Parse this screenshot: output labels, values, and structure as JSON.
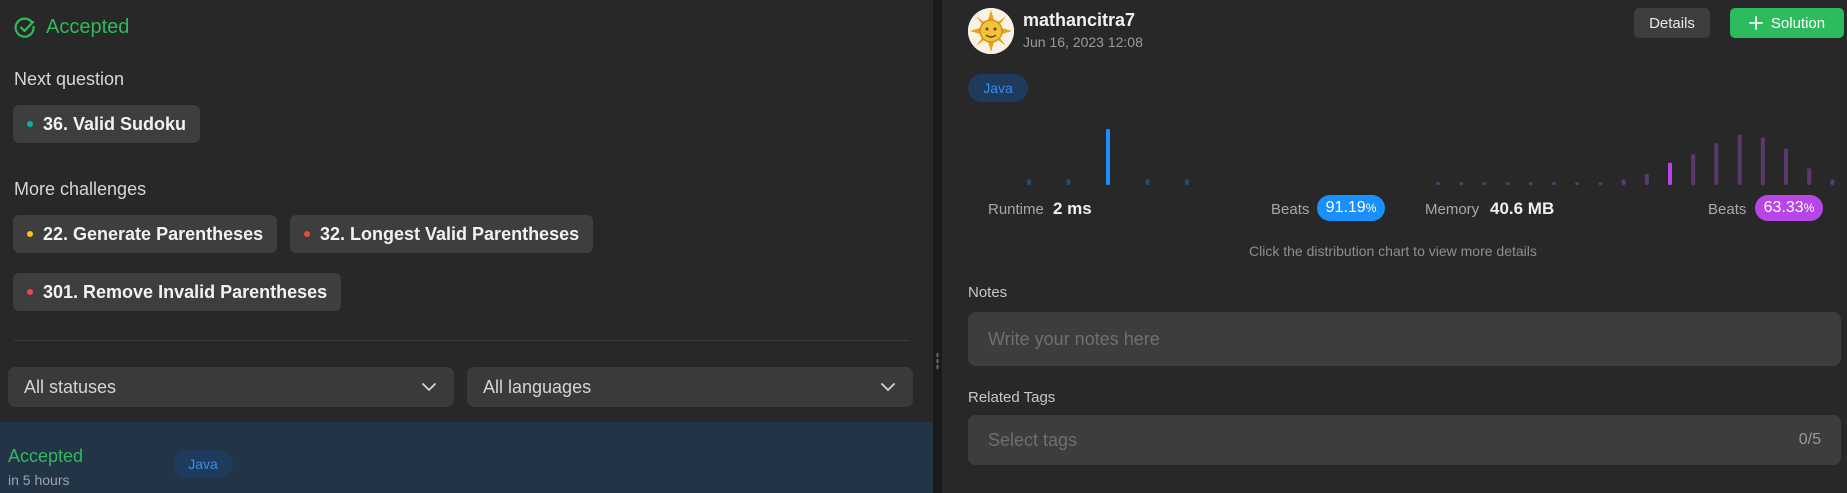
{
  "left": {
    "status_title": "Accepted",
    "next_label": "Next question",
    "next_question": {
      "text": "36. Valid Sudoku",
      "dot": "#00b8a3"
    },
    "more_label": "More challenges",
    "challenges": [
      {
        "text": "22. Generate Parentheses",
        "dot": "#ffc01e"
      },
      {
        "text": "32. Longest Valid Parentheses",
        "dot": "#ef4743"
      },
      {
        "text": "301. Remove Invalid Parentheses",
        "dot": "#ef4743"
      }
    ],
    "filters": {
      "status": "All statuses",
      "language": "All languages"
    },
    "submission": {
      "status": "Accepted",
      "time": "in 5 hours",
      "language": "Java"
    }
  },
  "right": {
    "user": {
      "name": "mathancitra7",
      "date": "Jun 16, 2023 12:08"
    },
    "details_label": "Details",
    "solution_label": "Solution",
    "language": "Java",
    "runtime": {
      "label": "Runtime",
      "value": "2 ms",
      "beats_label": "Beats",
      "beats_main": "91.19",
      "beats_unit": "%"
    },
    "memory": {
      "label": "Memory",
      "value": "40.6 MB",
      "beats_label": "Beats",
      "beats_main": "63.33",
      "beats_unit": "%"
    },
    "hint": "Click the distribution chart to view more details",
    "notes_label": "Notes",
    "notes_placeholder": "Write your notes here",
    "tags_label": "Related Tags",
    "tags_placeholder": "Select tags",
    "tags_count": "0/5"
  },
  "colors": {
    "accent_green": "#2cbb5d",
    "runtime_blue": "#1a90ff",
    "memory_purple": "#b845e6",
    "dim_blue": "#1f4d7a",
    "dim_purple": "#5a3a6e"
  },
  "chart_data": [
    {
      "type": "bar",
      "title": "",
      "series": [
        {
          "values": [
            1,
            1,
            10,
            1,
            1
          ]
        }
      ],
      "highlight_index": 2
    },
    {
      "type": "bar",
      "title": "",
      "series": [
        {
          "values": [
            0.5,
            0.5,
            0.5,
            0.5,
            0.5,
            0.5,
            0.5,
            0.5,
            1,
            2,
            4,
            5.5,
            7.5,
            9,
            8.5,
            6.5,
            3,
            1,
            0.5
          ]
        }
      ],
      "highlight_index": 10
    }
  ]
}
